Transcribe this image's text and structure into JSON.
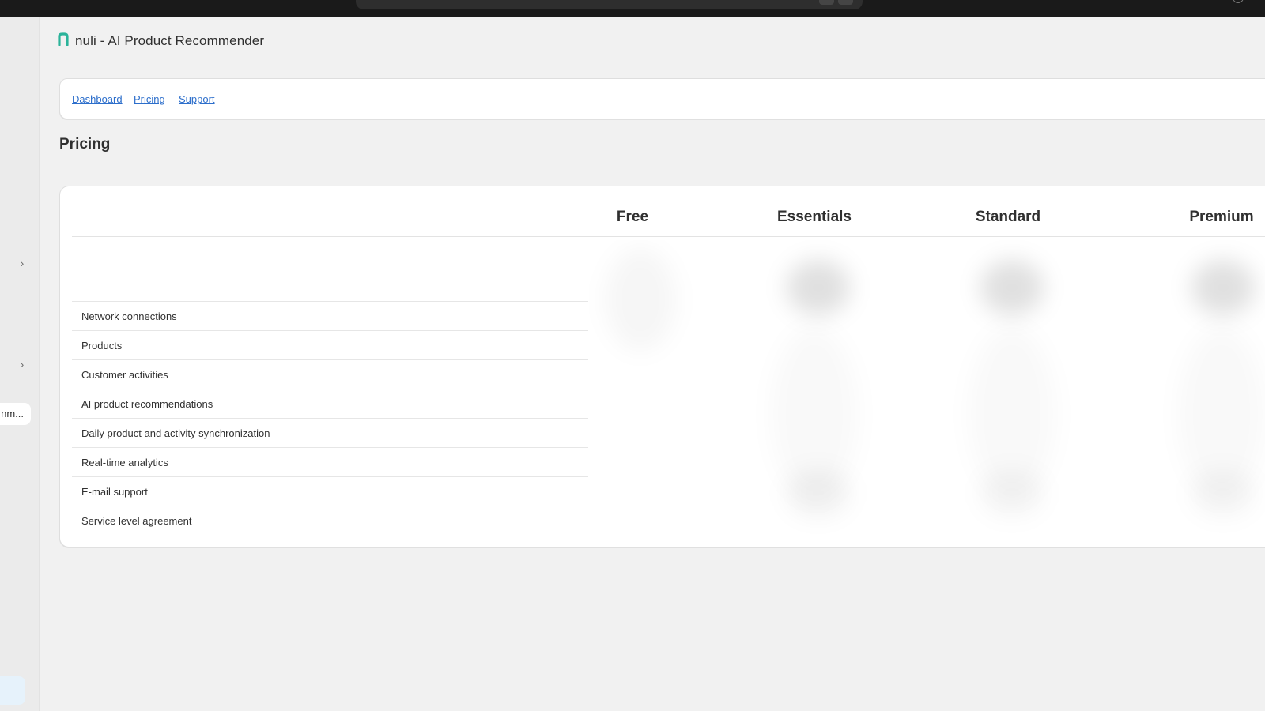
{
  "app": {
    "title": "nuli - AI Product Recommender",
    "brand_color": "#2bb39a"
  },
  "nav": {
    "links": [
      "Dashboard",
      "Pricing",
      "Support"
    ]
  },
  "page": {
    "title": "Pricing"
  },
  "sidebar": {
    "truncated_item_label": "nm..."
  },
  "pricing": {
    "plans": [
      "Free",
      "Essentials",
      "Standard",
      "Premium"
    ],
    "features": [
      "Network connections",
      "Products",
      "Customer activities",
      "AI product recommendations",
      "Daily product and activity synchronization",
      "Real-time analytics",
      "E-mail support",
      "Service level agreement"
    ]
  },
  "colors": {
    "link": "#2c6ecb",
    "background": "#f1f1f1",
    "card": "#ffffff",
    "topbar": "#1a1a1a"
  }
}
